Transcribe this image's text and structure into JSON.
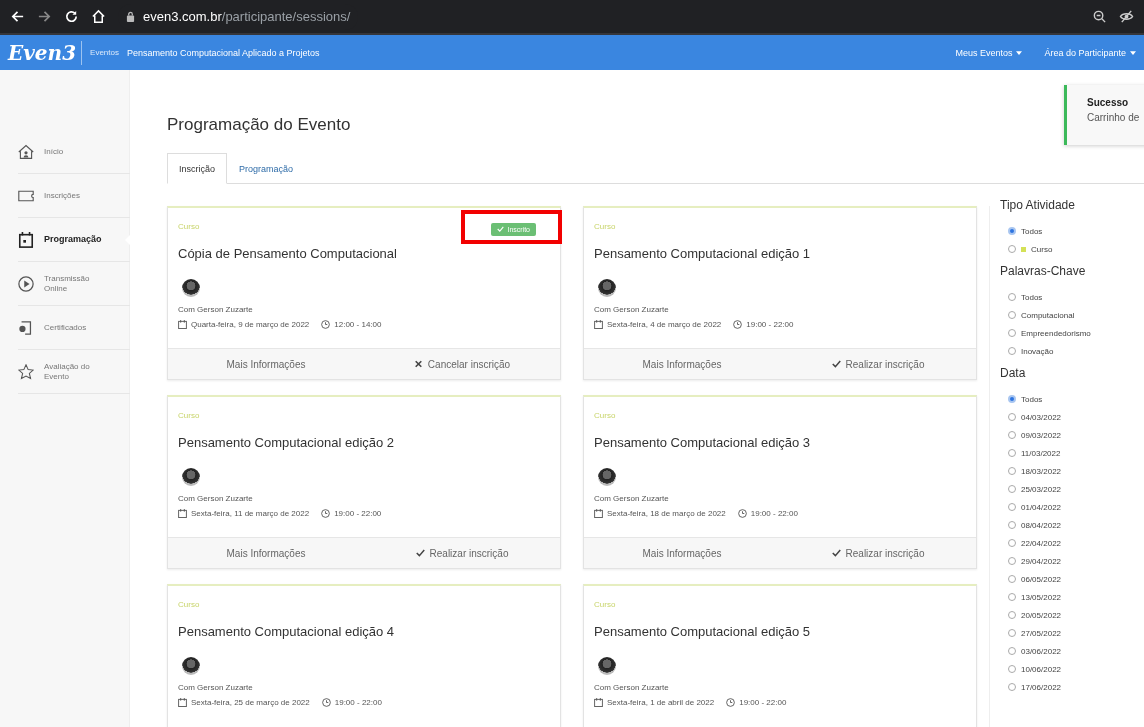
{
  "browser": {
    "url_host": "even3.com.br",
    "url_path": "/participante/sessions/"
  },
  "navbar": {
    "logo": "Even3",
    "section": "Eventos",
    "event_title": "Pensamento Computacional Aplicado a Projetos",
    "menus": [
      {
        "label": "Meus Eventos"
      },
      {
        "label": "Área do Participante"
      }
    ]
  },
  "sidebar": {
    "items": [
      {
        "label": "Início",
        "kind": "home",
        "selected": false
      },
      {
        "label": "Inscrições",
        "kind": "ticket",
        "selected": false
      },
      {
        "label": "Programação",
        "kind": "calendar",
        "selected": true
      },
      {
        "label": "Transmissão Online",
        "kind": "play",
        "selected": false
      },
      {
        "label": "Certificados",
        "kind": "certificate",
        "selected": false
      },
      {
        "label": "Avaliação do Evento",
        "kind": "star",
        "selected": false
      }
    ]
  },
  "toast": {
    "title": "Sucesso",
    "message": "Carrinho de"
  },
  "page_title": "Programação do Evento",
  "tabs": [
    {
      "label": "Inscrição",
      "selected": true
    },
    {
      "label": "Programação",
      "selected": false
    }
  ],
  "sessions": [
    {
      "type": "Curso",
      "title": "Cópia de Pensamento Computacional",
      "badge": "Inscrito",
      "speaker": "Com Gerson Zuzarte",
      "date": "Quarta-feira, 9 de março de 2022",
      "time": "12:00 - 14:00",
      "info": "Mais Informações",
      "action": {
        "kind": "cancel",
        "label": "Cancelar inscrição"
      }
    },
    {
      "type": "Curso",
      "title": "Pensamento Computacional edição 1",
      "speaker": "Com Gerson Zuzarte",
      "date": "Sexta-feira, 4 de março de 2022",
      "time": "19:00 - 22:00",
      "info": "Mais Informações",
      "action": {
        "kind": "register",
        "label": "Realizar inscrição"
      }
    },
    {
      "type": "Curso",
      "title": "Pensamento Computacional edição 2",
      "speaker": "Com Gerson Zuzarte",
      "date": "Sexta-feira, 11 de março de 2022",
      "time": "19:00 - 22:00",
      "info": "Mais Informações",
      "action": {
        "kind": "register",
        "label": "Realizar inscrição"
      }
    },
    {
      "type": "Curso",
      "title": "Pensamento Computacional edição 3",
      "speaker": "Com Gerson Zuzarte",
      "date": "Sexta-feira, 18 de março de 2022",
      "time": "19:00 - 22:00",
      "info": "Mais Informações",
      "action": {
        "kind": "register",
        "label": "Realizar inscrição"
      }
    },
    {
      "type": "Curso",
      "title": "Pensamento Computacional edição 4",
      "speaker": "Com Gerson Zuzarte",
      "date": "Sexta-feira, 25 de março de 2022",
      "time": "19:00 - 22:00"
    },
    {
      "type": "Curso",
      "title": "Pensamento Computacional edição 5",
      "speaker": "Com Gerson Zuzarte",
      "date": "Sexta-feira, 1 de abril de 2022",
      "time": "19:00 - 22:00"
    }
  ],
  "filters": [
    {
      "title": "Tipo Atividade",
      "options": [
        {
          "label": "Todos",
          "selected": true
        },
        {
          "label": "Curso",
          "selected": false,
          "color": "#d4e157"
        }
      ]
    },
    {
      "title": "Palavras-Chave",
      "options": [
        {
          "label": "Todos",
          "selected": false
        },
        {
          "label": "Computacional",
          "selected": false
        },
        {
          "label": "Empreendedorismo",
          "selected": false
        },
        {
          "label": "Inovação",
          "selected": false
        }
      ]
    },
    {
      "title": "Data",
      "options": [
        {
          "label": "Todos",
          "selected": true
        },
        {
          "label": "04/03/2022",
          "selected": false
        },
        {
          "label": "09/03/2022",
          "selected": false
        },
        {
          "label": "11/03/2022",
          "selected": false
        },
        {
          "label": "18/03/2022",
          "selected": false
        },
        {
          "label": "25/03/2022",
          "selected": false
        },
        {
          "label": "01/04/2022",
          "selected": false
        },
        {
          "label": "08/04/2022",
          "selected": false
        },
        {
          "label": "22/04/2022",
          "selected": false
        },
        {
          "label": "29/04/2022",
          "selected": false
        },
        {
          "label": "06/05/2022",
          "selected": false
        },
        {
          "label": "13/05/2022",
          "selected": false
        },
        {
          "label": "20/05/2022",
          "selected": false
        },
        {
          "label": "27/05/2022",
          "selected": false
        },
        {
          "label": "03/06/2022",
          "selected": false
        },
        {
          "label": "10/06/2022",
          "selected": false
        },
        {
          "label": "17/06/2022",
          "selected": false
        }
      ]
    }
  ]
}
